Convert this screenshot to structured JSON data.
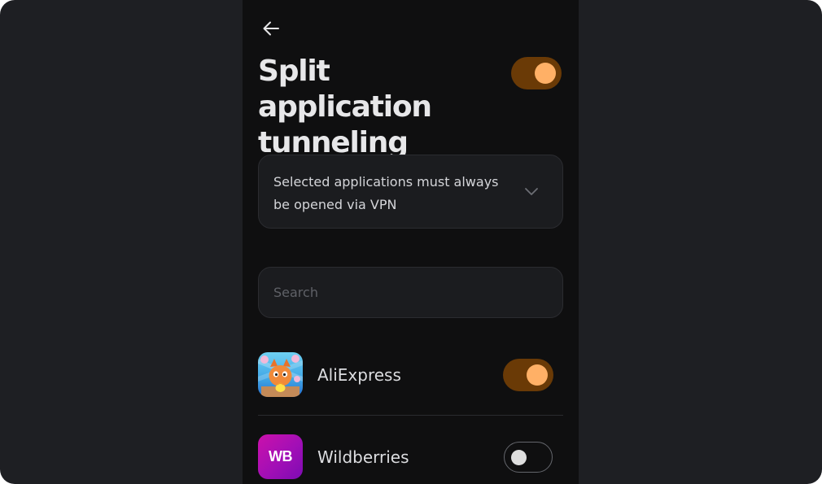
{
  "header": {
    "back_icon": "arrow-left-icon",
    "title": "Split application tunneling",
    "enabled": true
  },
  "mode": {
    "selected": "Selected applications must always be opened via VPN",
    "icon": "chevron-down-icon"
  },
  "search": {
    "placeholder": "Search",
    "value": ""
  },
  "apps": [
    {
      "name": "AliExpress",
      "icon": "aliexpress-app-icon",
      "enabled": true
    },
    {
      "name": "Wildberries",
      "icon": "wildberries-app-icon",
      "icon_text": "WB",
      "enabled": false
    }
  ],
  "colors": {
    "background": "#1e1f23",
    "panel": "#0f0f10",
    "accent": "#ffb066",
    "accent_track": "#6a3a06",
    "wildberries": "#cb11ab"
  }
}
